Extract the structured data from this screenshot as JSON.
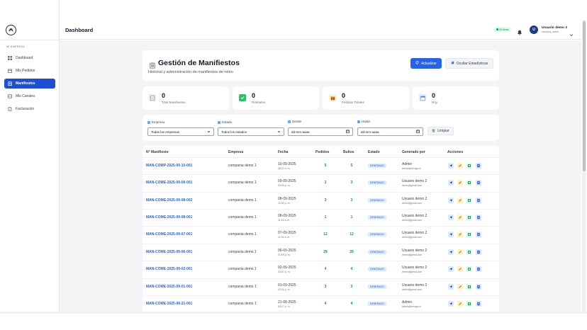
{
  "header": {
    "title": "Dashboard",
    "online": "En línea",
    "user_name": "Usuario demo 2",
    "user_role": "company_owner",
    "avatar_letter": "U"
  },
  "sidebar": {
    "section": "MI EMPRESA",
    "items": [
      {
        "label": "Dashboard"
      },
      {
        "label": "Mis Pedidos"
      },
      {
        "label": "Manifiestos"
      },
      {
        "label": "Mis Canales"
      },
      {
        "label": "Facturación"
      }
    ]
  },
  "page": {
    "title": "Gestión de Manifiestos",
    "subtitle": "Historial y administración de manifiestos de retiro",
    "refresh_label": "Actualizar",
    "hide_stats_label": "Ocultar Estadísticas"
  },
  "stats": [
    {
      "value": "0",
      "label": "Total Manifiestos",
      "color": "#e5e7eb"
    },
    {
      "value": "0",
      "label": "Retirados",
      "color": "#22c55e"
    },
    {
      "value": "0",
      "label": "Pedidos Totales",
      "color": "#fde68a"
    },
    {
      "value": "0",
      "label": "Hoy",
      "color": "#93c5fd"
    }
  ],
  "filters": {
    "empresa_label": "Empresa",
    "empresa_value": "Todas las empresas",
    "estado_label": "Estado",
    "estado_value": "Todos los estados",
    "desde_label": "Desde",
    "desde_placeholder": "dd-mm-aaaa",
    "hasta_label": "Hasta",
    "hasta_placeholder": "dd-mm-aaaa",
    "clear_label": "Limpiar"
  },
  "table": {
    "columns": [
      "N° Manifiesto",
      "Empresa",
      "Fecha",
      "Pedidos",
      "Bultos",
      "Estado",
      "Generado por",
      "Acciones"
    ],
    "rows": [
      {
        "id": "MAN-COMP-2025-09-10-001",
        "empresa": "compania demo 1",
        "fecha": "10-09-2025",
        "hora": "08:10 a. m.",
        "pedidos": "5",
        "bultos": "5",
        "estado": "GENERADO",
        "user": "Admin",
        "email": "admin@envigo.cl"
      },
      {
        "id": "MAN-COME-2025-09-09-001",
        "empresa": "compania demo 1",
        "fecha": "09-09-2025",
        "hora": "03:05 p. m.",
        "pedidos": "3",
        "bultos": "3",
        "estado": "GENERADO",
        "user": "Usuario demo 2",
        "email": "demo@gmail.com"
      },
      {
        "id": "MAN-COME-2025-09-08-002",
        "empresa": "compania demo 1",
        "fecha": "08-09-2025",
        "hora": "10:53 p. m.",
        "pedidos": "3",
        "bultos": "3",
        "estado": "GENERADO",
        "user": "Usuario demo 2",
        "email": "demo@gmail.com"
      },
      {
        "id": "MAN-COME-2025-09-08-001",
        "empresa": "compania demo 1",
        "fecha": "08-09-2025",
        "hora": "11:14 a. m.",
        "pedidos": "1",
        "bultos": "1",
        "estado": "GENERADO",
        "user": "Usuario demo 2",
        "email": "demo@gmail.com"
      },
      {
        "id": "MAN-COME-2025-09-07-001",
        "empresa": "compania demo 1",
        "fecha": "07-09-2025",
        "hora": "11:51 a. m.",
        "pedidos": "12",
        "bultos": "12",
        "estado": "GENERADO",
        "user": "Usuario demo 2",
        "email": "demo@gmail.com"
      },
      {
        "id": "MAN-COME-2025-09-06-001",
        "empresa": "compania demo 1",
        "fecha": "06-09-2025",
        "hora": "01:59 p. m.",
        "pedidos": "29",
        "bultos": "29",
        "estado": "GENERADO",
        "user": "Usuario demo 2",
        "email": "demo@gmail.com"
      },
      {
        "id": "MAN-COME-2025-09-02-001",
        "empresa": "compania demo 1",
        "fecha": "02-09-2025",
        "hora": "02:57 p. m.",
        "pedidos": "4",
        "bultos": "4",
        "estado": "GENERADO",
        "user": "Usuario demo 2",
        "email": "demo@gmail.com"
      },
      {
        "id": "MAN-COME-2025-09-01-001",
        "empresa": "compania demo 1",
        "fecha": "01-09-2025",
        "hora": "03:24 p. m.",
        "pedidos": "3",
        "bultos": "3",
        "estado": "GENERADO",
        "user": "Usuario demo 2",
        "email": "demo@gmail.com"
      },
      {
        "id": "MAN-COME-2025-08-21-001",
        "empresa": "compania demo 1",
        "fecha": "21-08-2025",
        "hora": "03:17 p. m.",
        "pedidos": "4",
        "bultos": "4",
        "estado": "GENERADO",
        "user": "Admin",
        "email": "admin@envigo.cl"
      }
    ]
  }
}
